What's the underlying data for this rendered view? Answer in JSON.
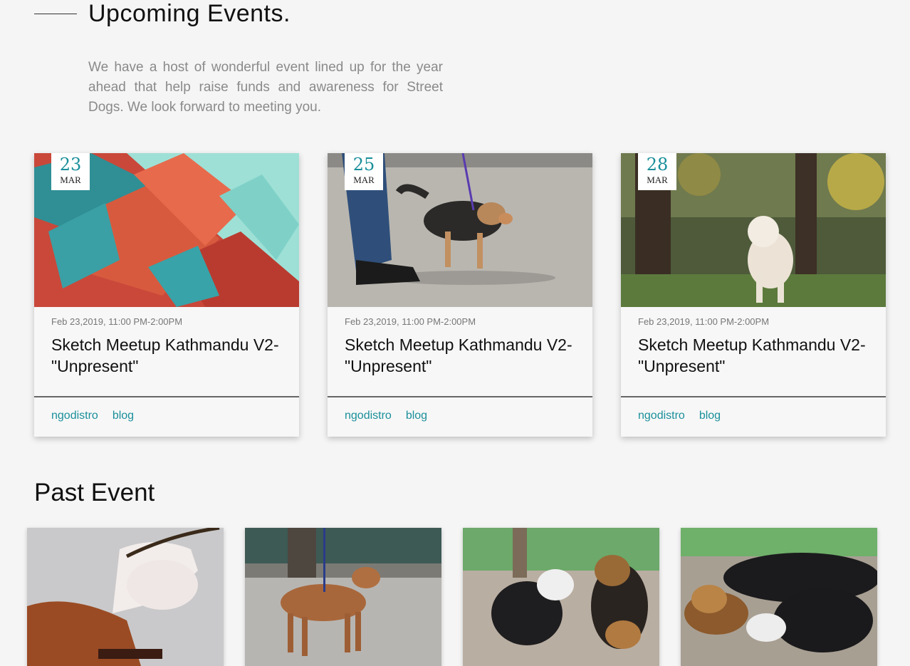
{
  "header": {
    "title": "Upcoming Events.",
    "intro": "We have a host of wonderful event lined up for the year ahead that help raise funds and awareness for Street Dogs. We look forward to meeting you."
  },
  "events": [
    {
      "day": "23",
      "month": "MAR",
      "time": "Feb 23,2019, 11:00 PM-2:00PM",
      "title": "Sketch Meetup Kathmandu V2-\"Unpresent\"",
      "tags": [
        "ngodistro",
        "blog"
      ],
      "image": "colorful-building-photo"
    },
    {
      "day": "25",
      "month": "MAR",
      "time": "Feb 23,2019, 11:00 PM-2:00PM",
      "title": "Sketch Meetup Kathmandu V2-\"Unpresent\"",
      "tags": [
        "ngodistro",
        "blog"
      ],
      "image": "dog-on-leash-photo"
    },
    {
      "day": "28",
      "month": "MAR",
      "time": "Feb 23,2019, 11:00 PM-2:00PM",
      "title": "Sketch Meetup Kathmandu V2-\"Unpresent\"",
      "tags": [
        "ngodistro",
        "blog"
      ],
      "image": "white-dog-forest-photo"
    }
  ],
  "past": {
    "title": "Past Event",
    "images": [
      "dogs-playing-photo",
      "brown-dog-street-photo",
      "dogs-barking-photo",
      "dogs-fighting-photo"
    ]
  },
  "colors": {
    "accent": "#1a8f9a",
    "background": "#f5f5f5",
    "muted_text": "#8a8a8a"
  }
}
